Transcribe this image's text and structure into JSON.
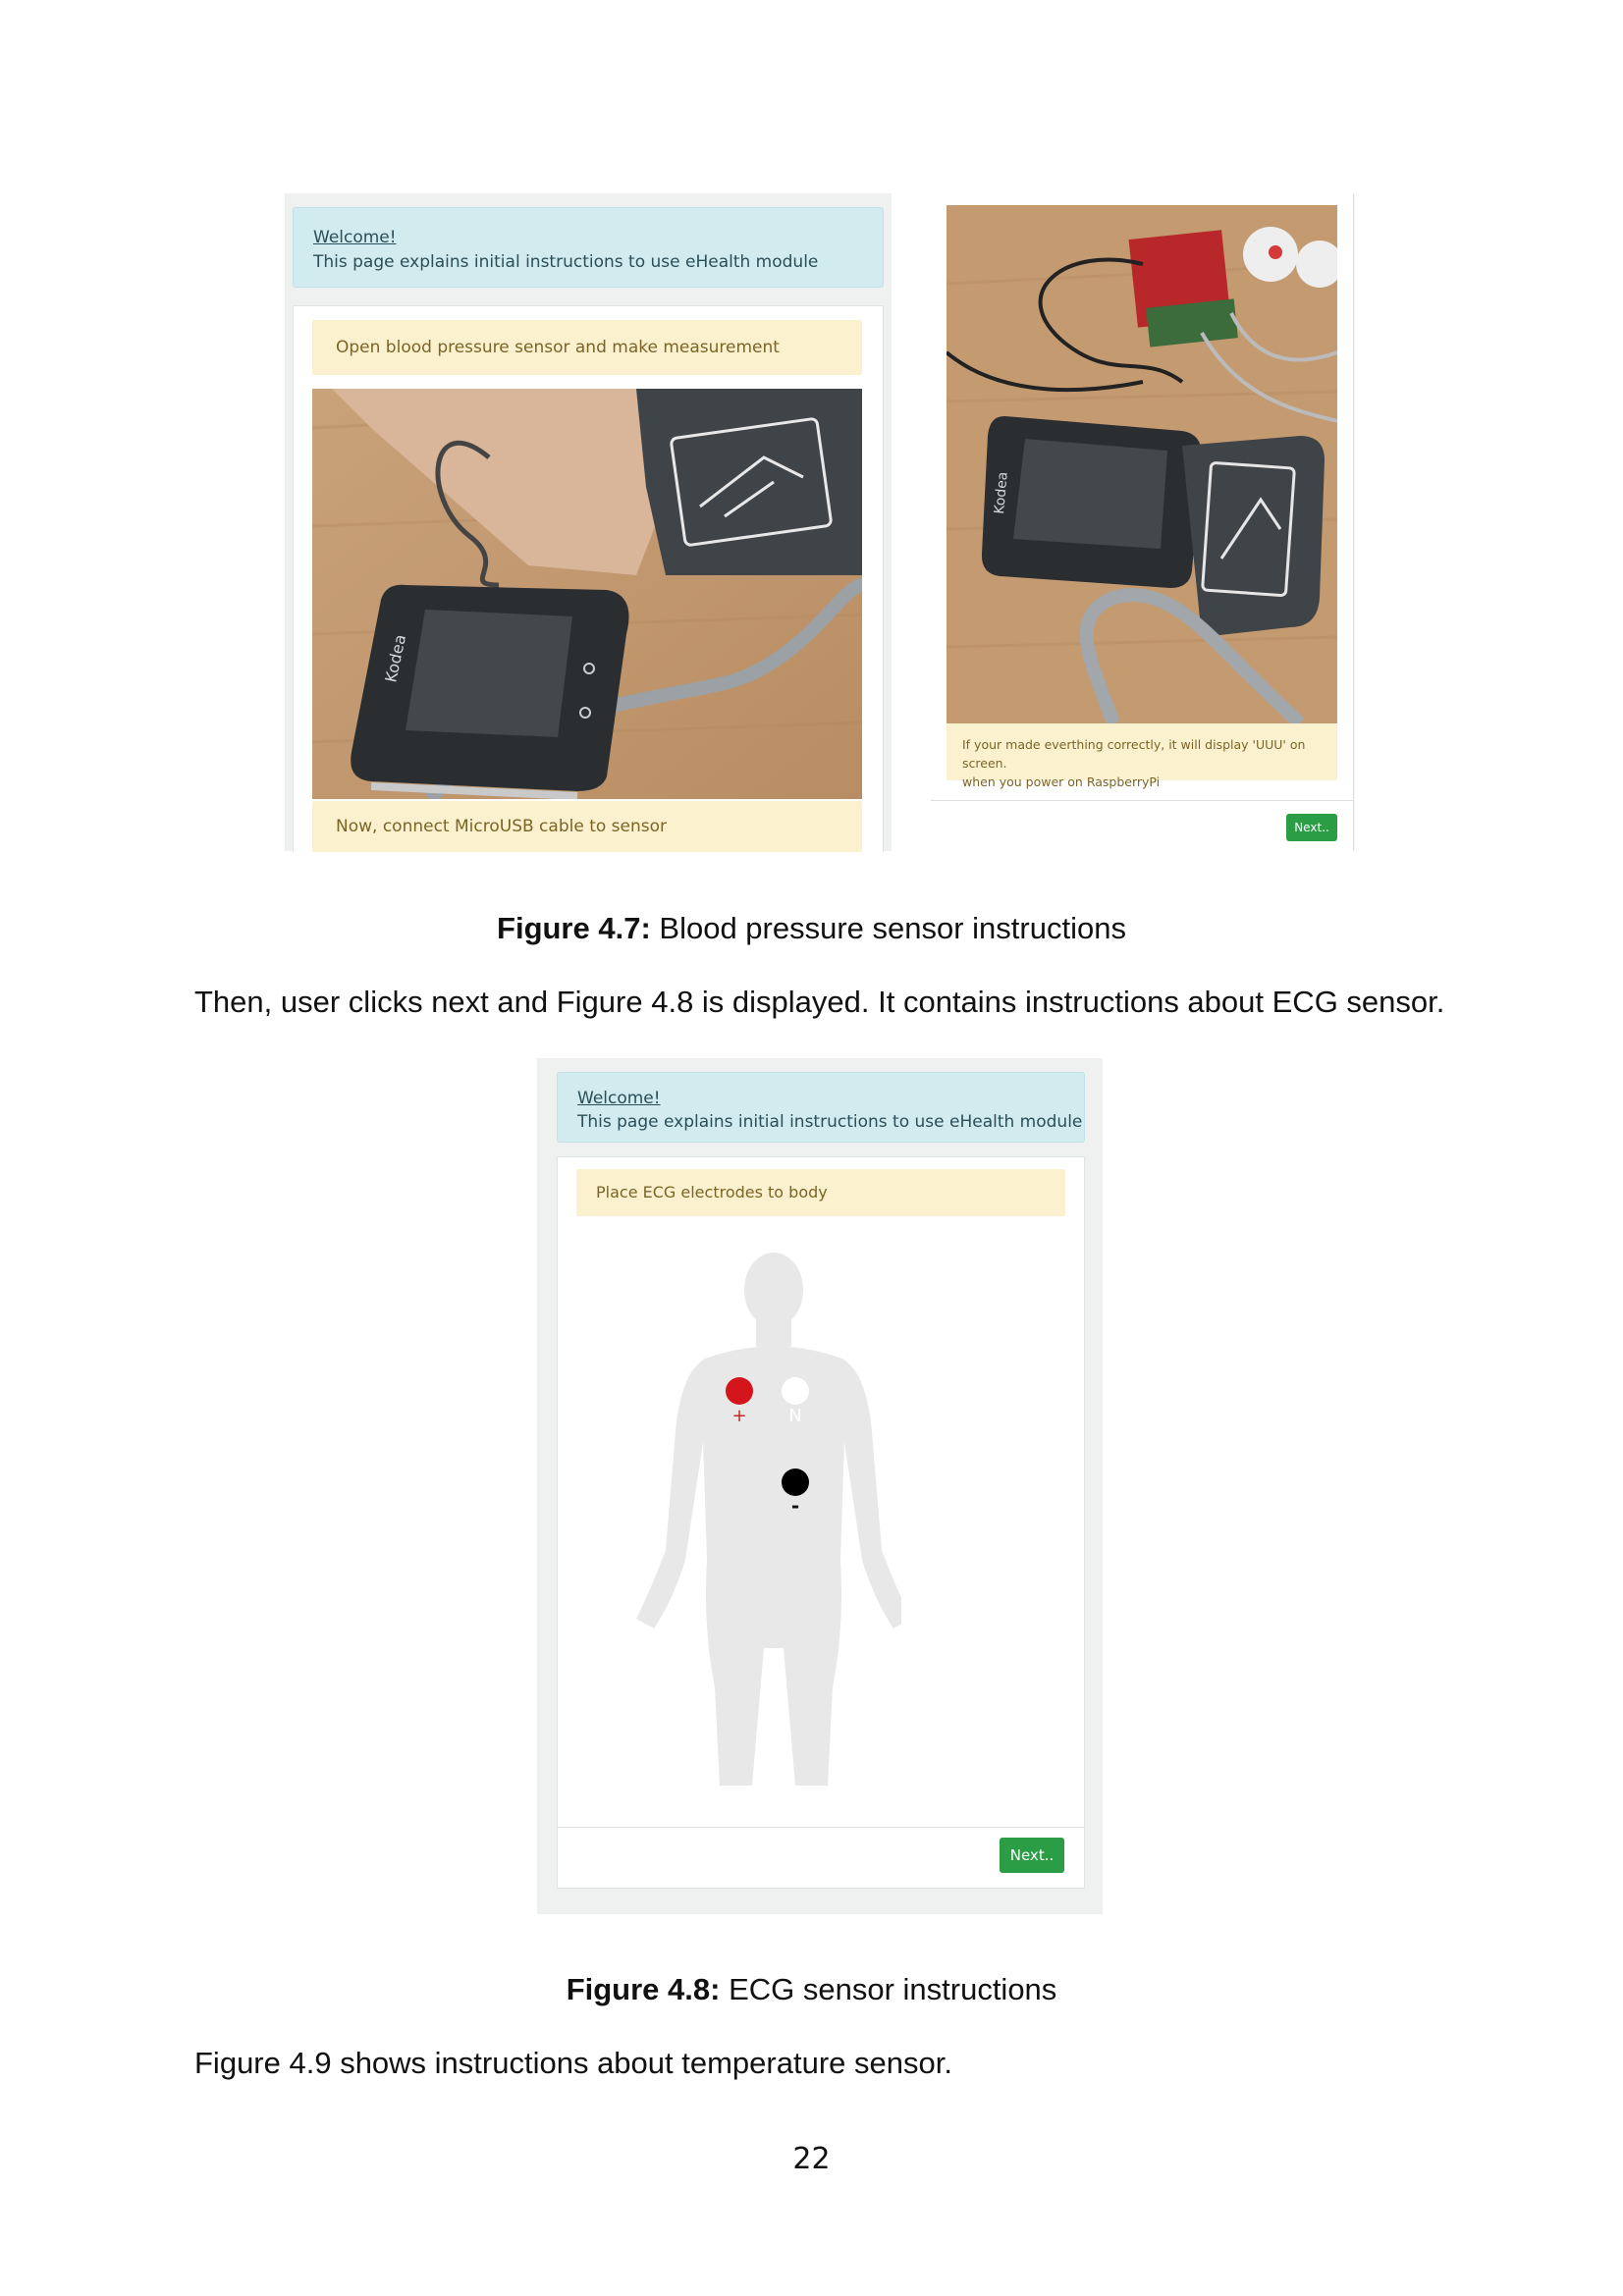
{
  "figure_4_7": {
    "left_screen": {
      "welcome": "Welcome!",
      "intro": "This page explains initial instructions to use eHealth module",
      "step1": "Open blood pressure sensor and make measurement",
      "step2": "Now, connect MicroUSB cable to sensor",
      "photo_device_brand": "Kodea"
    },
    "right_screen": {
      "photo_device_brand": "Kodea",
      "notice_line1": "If your made everthing correctly, it will display 'UUU' on screen.",
      "notice_line2": "when you power on RaspberryPi",
      "next_button": "Next.."
    },
    "caption_label": "Figure 4.7:",
    "caption_text": " Blood pressure sensor instructions"
  },
  "paragraph1": "Then, user clicks next and Figure 4.8 is displayed. It contains instructions about ECG sensor.",
  "figure_4_8": {
    "welcome": "Welcome!",
    "intro": "This page explains initial instructions to use eHealth module",
    "step": "Place ECG electrodes to body",
    "electrodes": {
      "positive_label": "+",
      "neutral_label": "N",
      "negative_label": "-",
      "positive_color": "#d4161c",
      "neutral_color": "#ffffff",
      "negative_color": "#000000"
    },
    "next_button": "Next..",
    "caption_label": "Figure 4.8:",
    "caption_text": " ECG sensor instructions"
  },
  "paragraph2": "Figure 4.9 shows instructions about temperature sensor.",
  "page_number": "22"
}
